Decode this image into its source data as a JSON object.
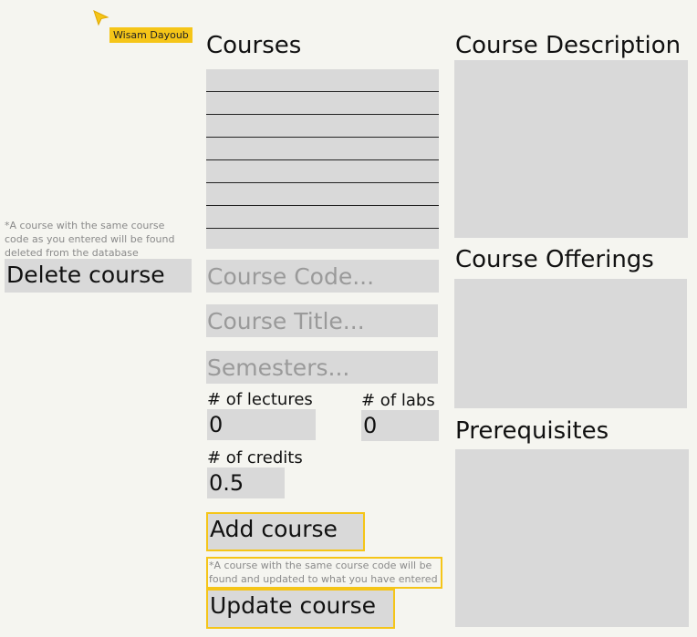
{
  "collaborator": {
    "name": "Wisam Dayoub"
  },
  "delete_section": {
    "note": "*A course with the same course code as you entered will be found deleted from the database",
    "delete_label": "Delete course"
  },
  "courses": {
    "title": "Courses",
    "code_placeholder": "Course Code...",
    "title_placeholder": "Course Title...",
    "semesters_placeholder": "Semesters...",
    "lectures_label": "# of lectures",
    "lectures_value": "0",
    "labs_label": "# of labs",
    "labs_value": "0",
    "credits_label": "# of credits",
    "credits_value": "0.5",
    "add_label": "Add course",
    "update_note": "*A course with the same course code will be found and updated to what you have entered",
    "update_label": "Update course"
  },
  "right_panels": {
    "description_title": "Course Description",
    "offerings_title": "Course Offerings",
    "prerequisites_title": "Prerequisites"
  },
  "colors": {
    "background": "#f5f5f0",
    "placeholder_fill": "#d9d9d9",
    "highlight": "#f5c518",
    "placeholder_text": "#9a9a9a"
  }
}
